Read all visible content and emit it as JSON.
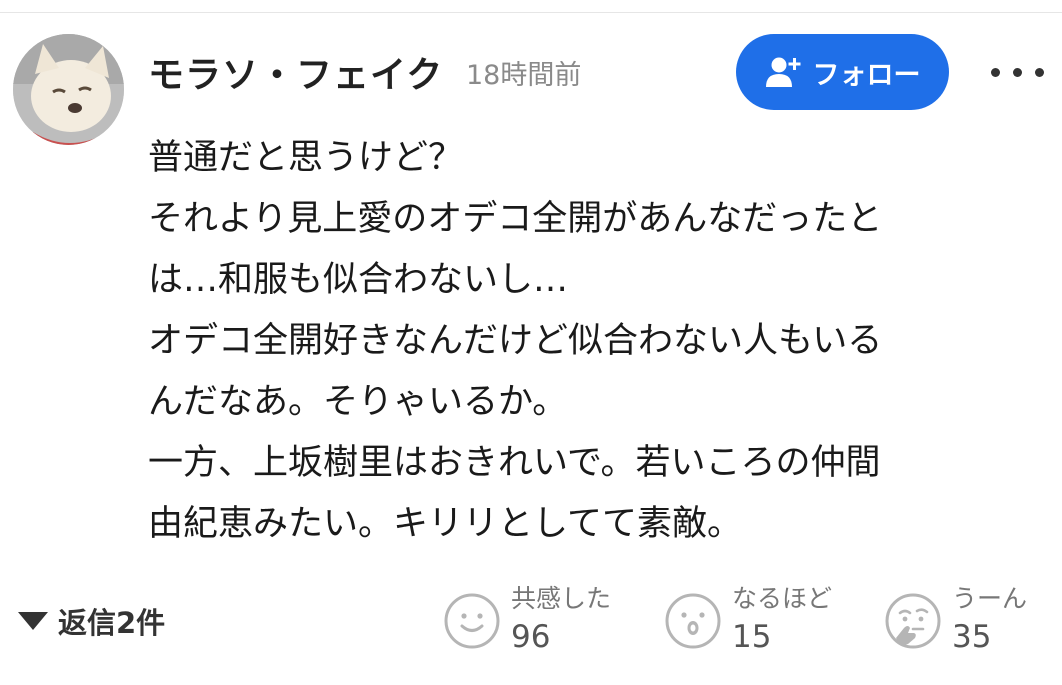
{
  "comment": {
    "author": "モラソ・フェイク",
    "timestamp": "18時間前",
    "follow_label": "フォロー",
    "more_icon": "more-dots-icon",
    "avatar_icon": "dog-avatar",
    "body_lines": [
      "普通だと思うけど？",
      "それより見上愛のオデコ全開があんなだったとは…和服も似合わないし…",
      "オデコ全開好きなんだけど似合わない人もいるんだなあ。そりゃいるか。",
      "一方、上坂樹里はおきれいで。若いころの仲間由紀恵みたい。キリリとしてて素敵。"
    ],
    "display_lines": [
      "普通だと思うけど？",
      "それより見上愛のオデコ全開があんなだったと",
      "は…和服も似合わないし…",
      "オデコ全開好きなんだけど似合わない人もいる",
      "んだなあ。そりゃいるか。",
      "一方、上坂樹里はおきれいで。若いころの仲間",
      "由紀恵みたい。キリリとしてて素敵。"
    ]
  },
  "replies": {
    "label": "返信2件",
    "icon": "triangle-down-icon"
  },
  "reactions": [
    {
      "label": "共感した",
      "count": "96",
      "icon": "smile-face-icon"
    },
    {
      "label": "なるほど",
      "count": "15",
      "icon": "surprised-face-icon"
    },
    {
      "label": "うーん",
      "count": "35",
      "icon": "thinking-face-icon"
    }
  ],
  "colors": {
    "accent": "#1f6fe8",
    "muted_text": "#8a8a8a",
    "icon_gray": "#b5b5b5"
  }
}
